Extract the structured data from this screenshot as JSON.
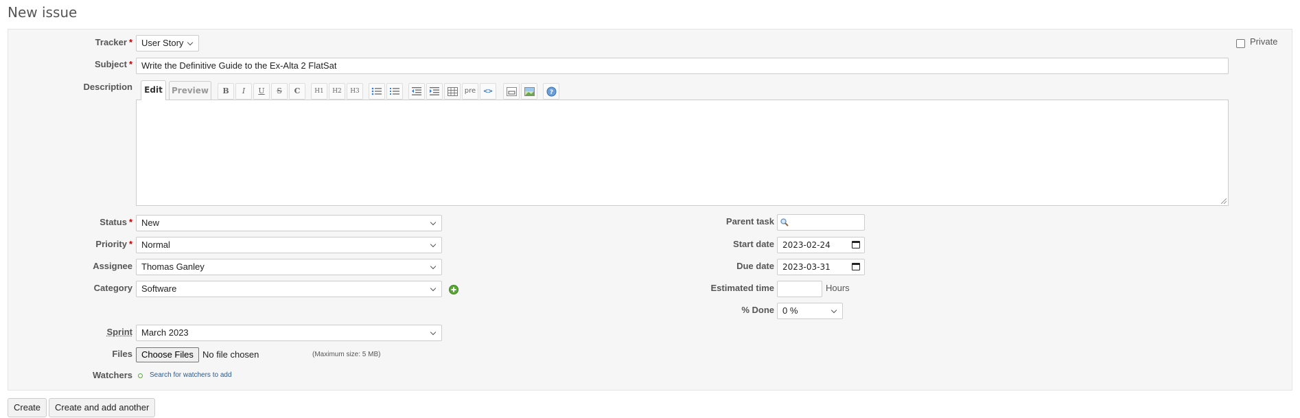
{
  "page": {
    "title": "New issue"
  },
  "form": {
    "tracker": {
      "label": "Tracker",
      "value": "User Story"
    },
    "private": {
      "label": "Private",
      "checked": false
    },
    "subject": {
      "label": "Subject",
      "value": "Write the Definitive Guide to the Ex-Alta 2 FlatSat"
    },
    "description": {
      "label": "Description",
      "tabs": [
        "Edit",
        "Preview"
      ],
      "active_tab": "Edit",
      "toolbar": {
        "bold": "B",
        "italic": "I",
        "underline": "U",
        "strike": "S",
        "code_inline": "C",
        "h1": "H1",
        "h2": "H2",
        "h3": "H3",
        "pre": "pre"
      },
      "value": ""
    },
    "status": {
      "label": "Status",
      "value": "New"
    },
    "priority": {
      "label": "Priority",
      "value": "Normal"
    },
    "assignee": {
      "label": "Assignee",
      "value": "Thomas Ganley"
    },
    "category": {
      "label": "Category",
      "value": "Software"
    },
    "sprint": {
      "label": "Sprint",
      "value": "March 2023"
    },
    "files": {
      "label": "Files",
      "button": "Choose Files",
      "status": "No file chosen",
      "max_size": "(Maximum size: 5 MB)"
    },
    "watchers": {
      "label": "Watchers",
      "link": "Search for watchers to add"
    },
    "parent_task": {
      "label": "Parent task",
      "value": ""
    },
    "start_date": {
      "label": "Start date",
      "value": "2023-02-24"
    },
    "due_date": {
      "label": "Due date",
      "value": "2023-03-31"
    },
    "estimated_time": {
      "label": "Estimated time",
      "value": "",
      "unit": "Hours"
    },
    "done": {
      "label": "% Done",
      "value": "0 %"
    },
    "required_mark": "*"
  },
  "actions": {
    "create": "Create",
    "create_another": "Create and add another"
  },
  "colors": {
    "required": "#bb0000",
    "link": "#2a5a8a",
    "add_icon": "#5ca835"
  }
}
